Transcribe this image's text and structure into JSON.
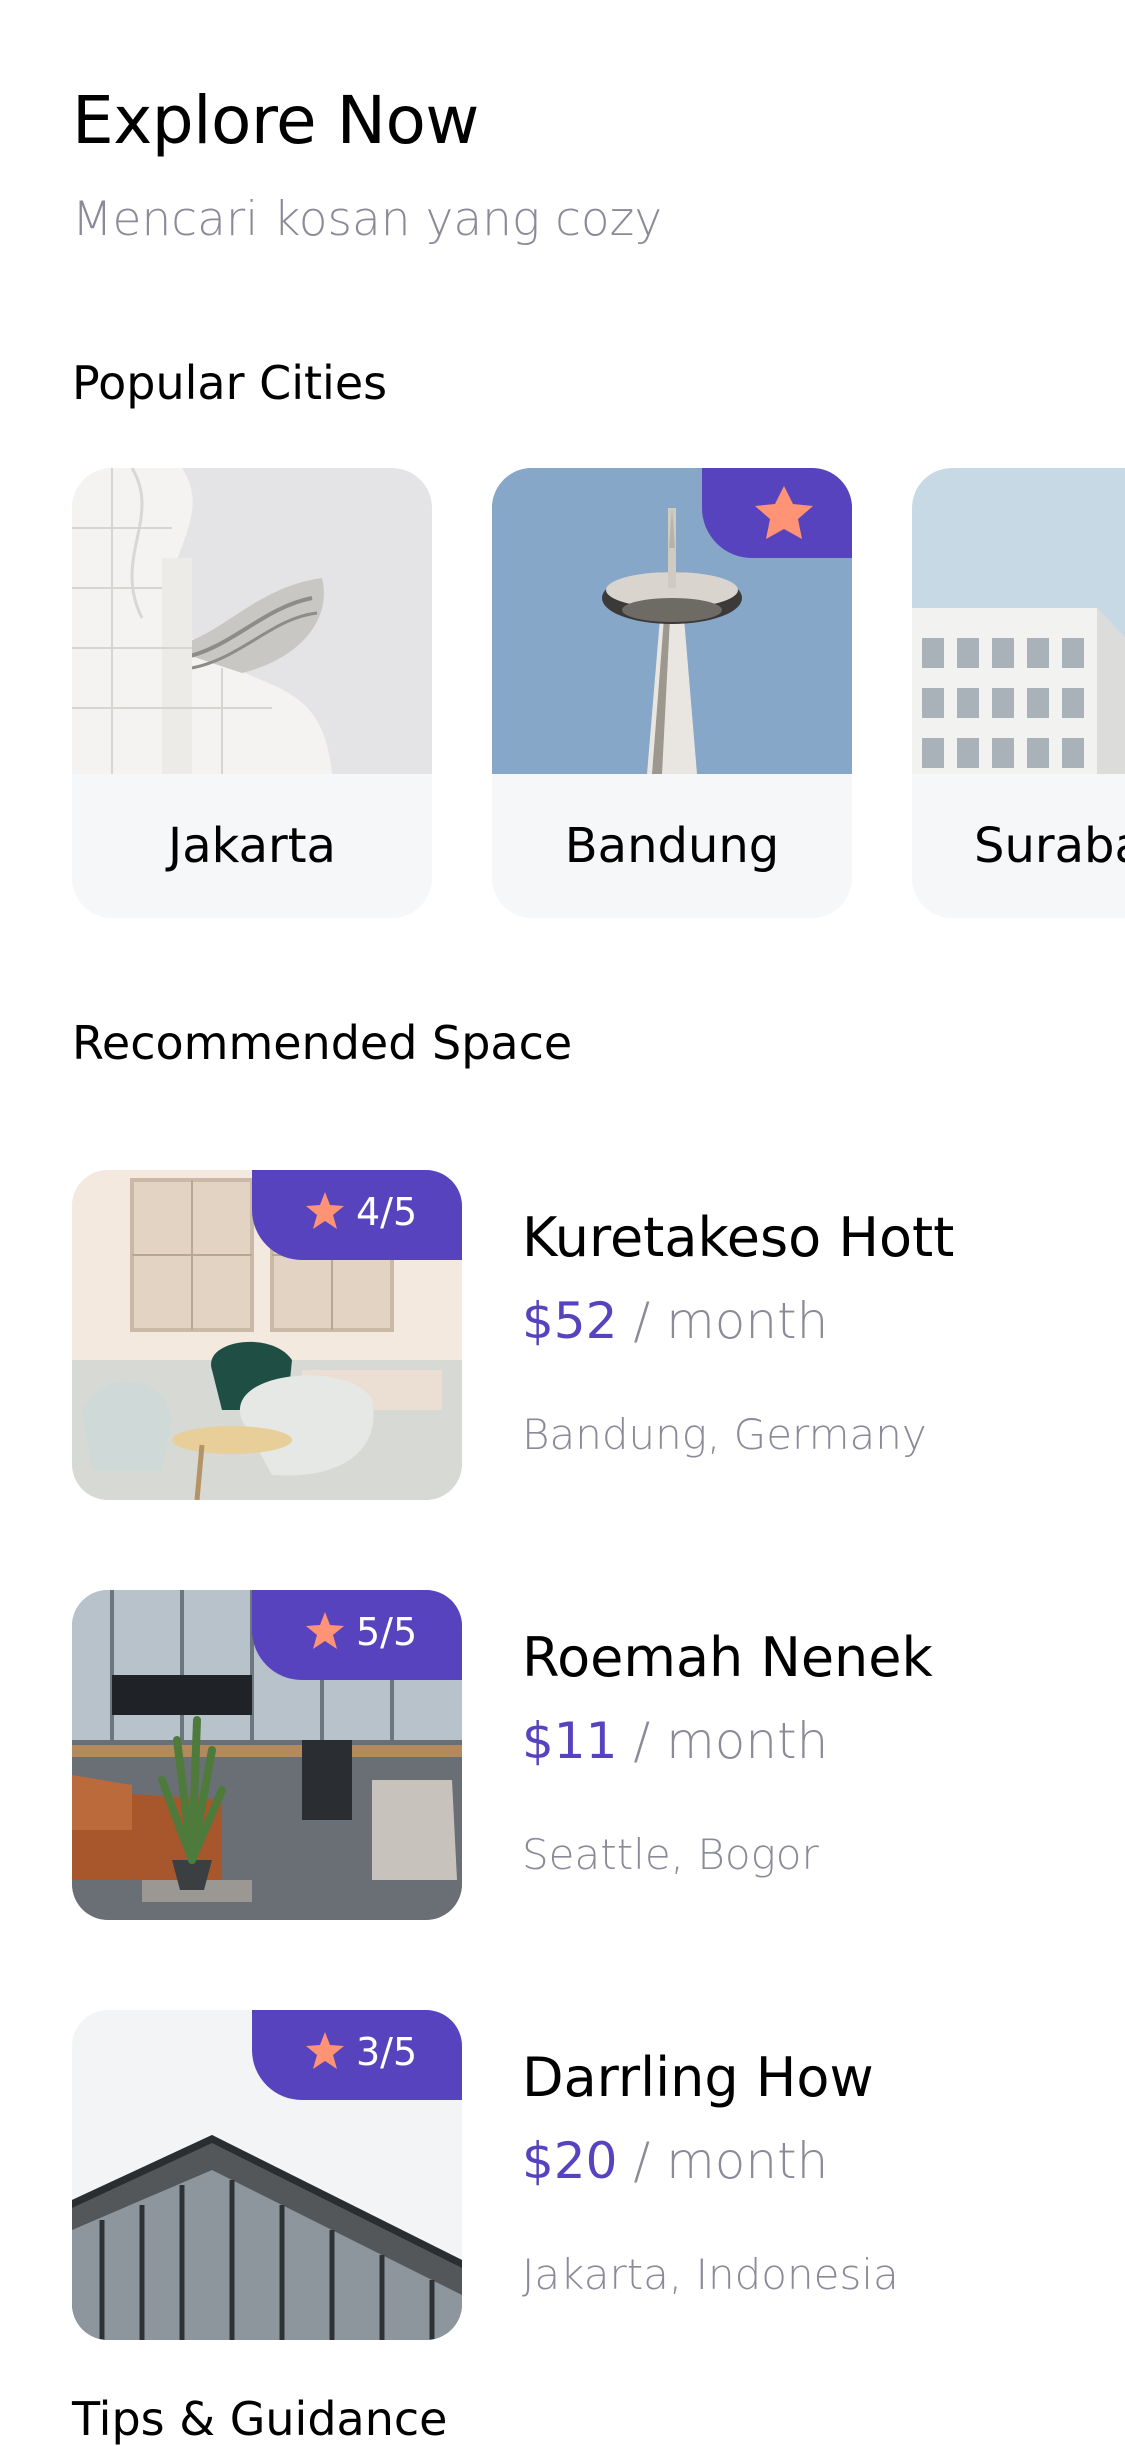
{
  "header": {
    "title": "Explore Now",
    "subtitle": "Mencari kosan yang cozy"
  },
  "popular": {
    "heading": "Popular Cities",
    "cities": [
      {
        "name": "Jakarta",
        "favorite": false
      },
      {
        "name": "Bandung",
        "favorite": true
      },
      {
        "name": "Surabaya",
        "favorite": false
      }
    ]
  },
  "recommended": {
    "heading": "Recommended Space",
    "spaces": [
      {
        "rating": "4/5",
        "name": "Kuretakeso Hott",
        "price": "$52",
        "per": " / month",
        "location": "Bandung, Germany"
      },
      {
        "rating": "5/5",
        "name": "Roemah Nenek",
        "price": "$11",
        "per": " / month",
        "location": "Seattle, Bogor"
      },
      {
        "rating": "3/5",
        "name": "Darrling How",
        "price": "$20",
        "per": " / month",
        "location": "Jakarta, Indonesia"
      }
    ]
  },
  "tips": {
    "heading": "Tips & Guidance"
  },
  "colors": {
    "accent": "#5843be",
    "star": "#ff9376",
    "muted": "#8a8a99",
    "card_bg": "#f6f7f8"
  }
}
